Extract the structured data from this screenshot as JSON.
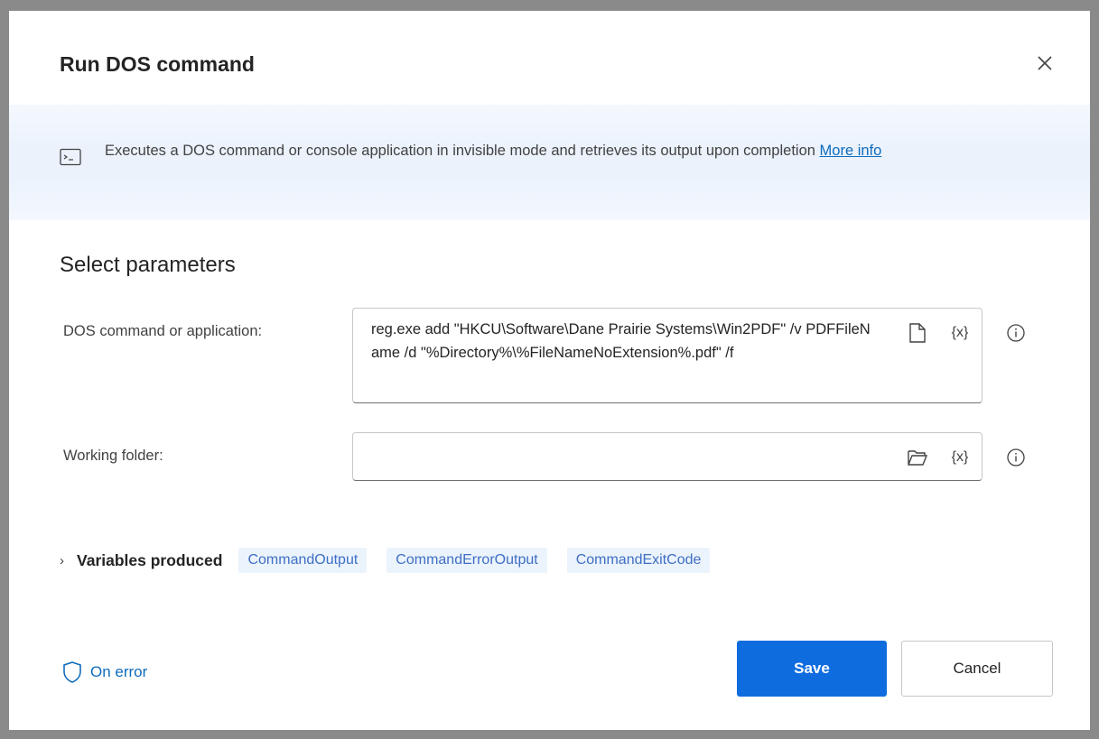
{
  "dialog": {
    "title": "Run DOS command"
  },
  "banner": {
    "text": "Executes a DOS command or console application in invisible mode and retrieves its output upon completion",
    "link": "More info"
  },
  "section_title": "Select parameters",
  "params": {
    "command_label": "DOS command or application:",
    "command_value": "reg.exe add \"HKCU\\Software\\Dane Prairie Systems\\Win2PDF\" /v PDFFileName /d \"%Directory%\\%FileNameNoExtension%.pdf\" /f",
    "working_folder_label": "Working folder:",
    "working_folder_value": "",
    "variable_button": "{x}"
  },
  "variables": {
    "label": "Variables produced",
    "chips": [
      "CommandOutput",
      "CommandErrorOutput",
      "CommandExitCode"
    ]
  },
  "footer": {
    "on_error": "On error",
    "save": "Save",
    "cancel": "Cancel"
  },
  "colors": {
    "accent": "#0f6cdf",
    "link": "#0f6cbd",
    "chip_bg": "#ebf3fc"
  }
}
